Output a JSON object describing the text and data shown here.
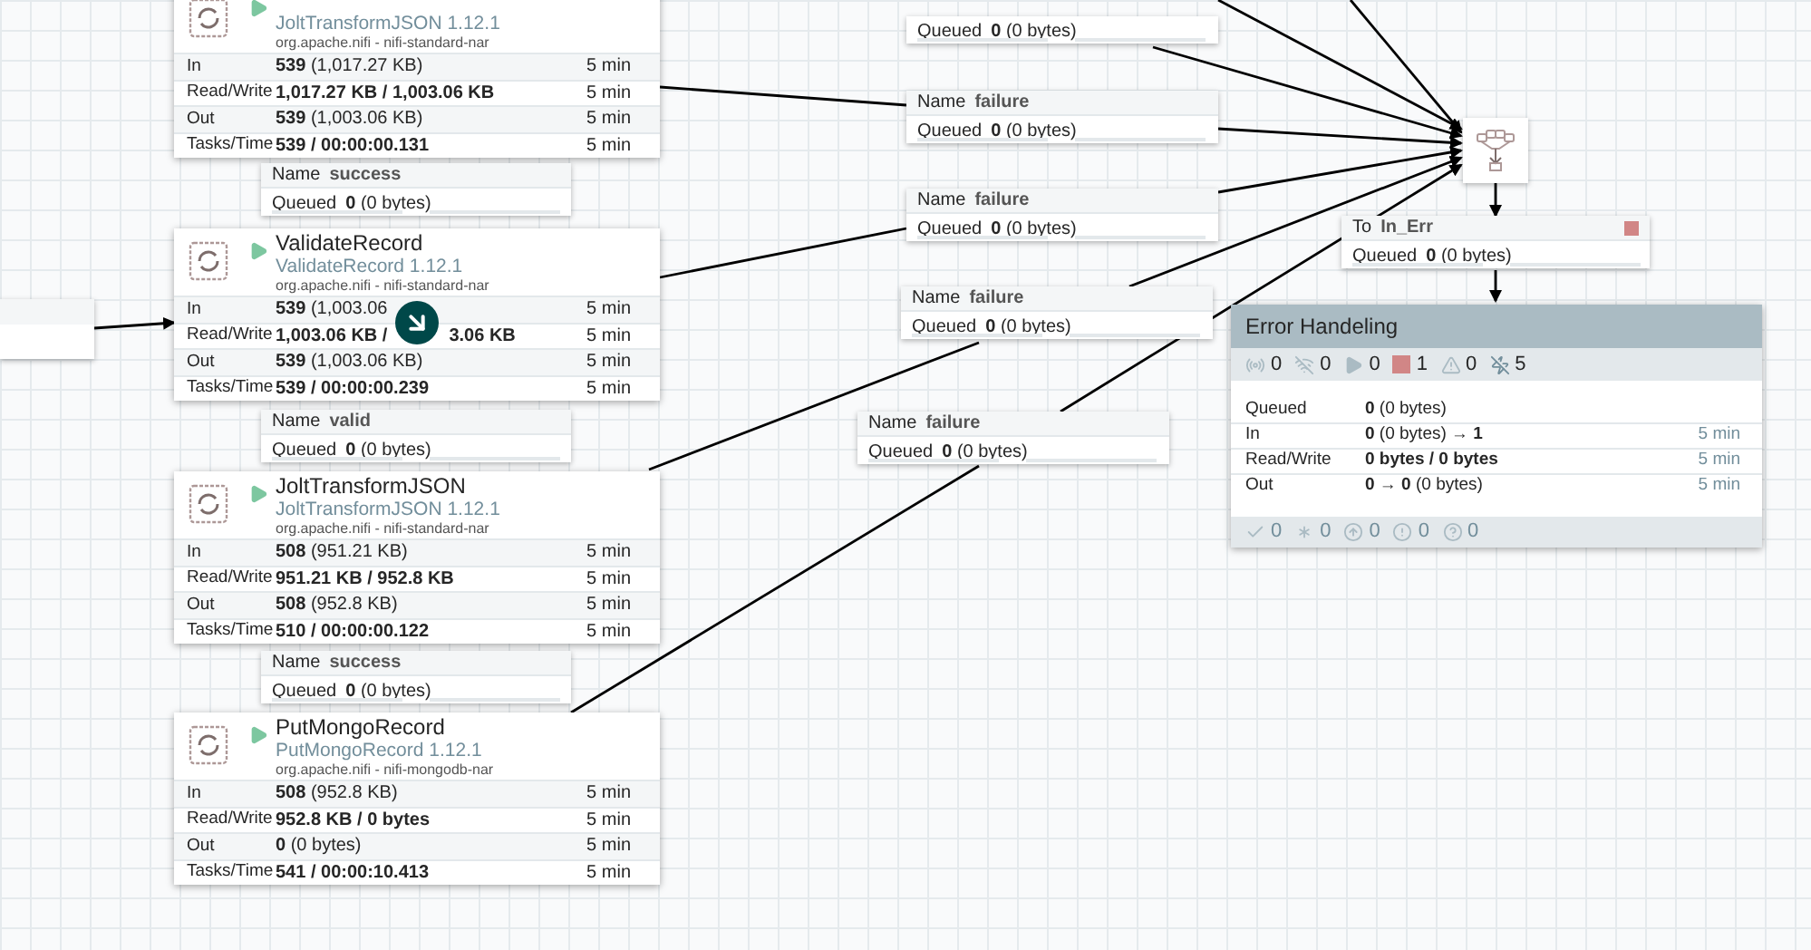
{
  "processors": [
    {
      "subtitle": "JoltTransformJSON 1.12.1",
      "bundle": "org.apache.nifi - nifi-standard-nar",
      "running": true,
      "rows": [
        {
          "label": "In",
          "value": "539",
          "detail": "(1,017.27 KB)",
          "time": "5 min"
        },
        {
          "label": "Read/Write",
          "value": "1,017.27 KB / 1,003.06 KB",
          "time": "5 min"
        },
        {
          "label": "Out",
          "value": "539",
          "detail": "(1,003.06 KB)",
          "time": "5 min"
        },
        {
          "label": "Tasks/Time",
          "value": "539 / 00:00:00.131",
          "time": "5 min"
        }
      ],
      "connection": {
        "name_label": "Name",
        "name": "success",
        "queued_label": "Queued",
        "count": "0",
        "size": "(0 bytes)"
      }
    },
    {
      "name": "ValidateRecord",
      "subtitle": "ValidateRecord 1.12.1",
      "bundle": "org.apache.nifi - nifi-standard-nar",
      "running": true,
      "rows": [
        {
          "label": "In",
          "value": "539",
          "detail": "(1,003.06",
          "time": "5 min"
        },
        {
          "label": "Read/Write",
          "value": "1,003.06 KB /",
          "after": "3.06 KB",
          "time": "5 min"
        },
        {
          "label": "Out",
          "value": "539",
          "detail": "(1,003.06 KB)",
          "time": "5 min"
        },
        {
          "label": "Tasks/Time",
          "value": "539 / 00:00:00.239",
          "time": "5 min"
        }
      ],
      "connection": {
        "name_label": "Name",
        "name": "valid",
        "queued_label": "Queued",
        "count": "0",
        "size": "(0 bytes)"
      }
    },
    {
      "name": "JoltTransformJSON",
      "subtitle": "JoltTransformJSON 1.12.1",
      "bundle": "org.apache.nifi - nifi-standard-nar",
      "running": true,
      "rows": [
        {
          "label": "In",
          "value": "508",
          "detail": "(951.21 KB)",
          "time": "5 min"
        },
        {
          "label": "Read/Write",
          "value": "951.21 KB / 952.8 KB",
          "time": "5 min"
        },
        {
          "label": "Out",
          "value": "508",
          "detail": "(952.8 KB)",
          "time": "5 min"
        },
        {
          "label": "Tasks/Time",
          "value": "510 / 00:00:00.122",
          "time": "5 min"
        }
      ],
      "connection": {
        "name_label": "Name",
        "name": "success",
        "queued_label": "Queued",
        "count": "0",
        "size": "(0 bytes)"
      }
    },
    {
      "name": "PutMongoRecord",
      "subtitle": "PutMongoRecord 1.12.1",
      "bundle": "org.apache.nifi - nifi-mongodb-nar",
      "running": true,
      "rows": [
        {
          "label": "In",
          "value": "508",
          "detail": "(952.8 KB)",
          "time": "5 min"
        },
        {
          "label": "Read/Write",
          "value": "952.8 KB / 0 bytes",
          "time": "5 min"
        },
        {
          "label": "Out",
          "value": "0",
          "detail": "(0 bytes)",
          "time": "5 min"
        },
        {
          "label": "Tasks/Time",
          "value": "541 / 00:00:10.413",
          "time": "5 min"
        }
      ]
    }
  ],
  "failure_connections": [
    {
      "queued_label": "Queued",
      "count": "0",
      "size": "(0 bytes)"
    },
    {
      "name_label": "Name",
      "name": "failure",
      "queued_label": "Queued",
      "count": "0",
      "size": "(0 bytes)"
    },
    {
      "name_label": "Name",
      "name": "failure",
      "queued_label": "Queued",
      "count": "0",
      "size": "(0 bytes)"
    },
    {
      "name_label": "Name",
      "name": "failure",
      "queued_label": "Queued",
      "count": "0",
      "size": "(0 bytes)"
    },
    {
      "name_label": "Name",
      "name": "failure",
      "queued_label": "Queued",
      "count": "0",
      "size": "(0 bytes)"
    }
  ],
  "output_connection": {
    "name_label": "To",
    "name": "In_Err",
    "queued_label": "Queued",
    "count": "0",
    "size": "(0 bytes)",
    "destination_stopped": true
  },
  "process_group": {
    "title": "Error Handeling",
    "status": [
      {
        "kind": "transmitting",
        "count": "0"
      },
      {
        "kind": "not_transmitting",
        "count": "0"
      },
      {
        "kind": "running",
        "count": "0"
      },
      {
        "kind": "stopped",
        "count": "1"
      },
      {
        "kind": "invalid",
        "count": "0"
      },
      {
        "kind": "disabled",
        "count": "5"
      }
    ],
    "rows": [
      {
        "label": "Queued",
        "value": "0",
        "detail": "(0 bytes)"
      },
      {
        "label": "In",
        "value": "0",
        "detail": "(0 bytes)",
        "after": "→ 1",
        "time": "5 min"
      },
      {
        "label": "Read/Write",
        "value": "0 bytes / 0 bytes",
        "time": "5 min"
      },
      {
        "label": "Out",
        "value": "0 → 0",
        "detail": "(0 bytes)",
        "time": "5 min"
      }
    ],
    "versions": [
      {
        "kind": "up_to_date",
        "count": "0"
      },
      {
        "kind": "locally_modified",
        "count": "0"
      },
      {
        "kind": "stale",
        "count": "0"
      },
      {
        "kind": "sync_failure",
        "count": "0"
      },
      {
        "kind": "unknown",
        "count": "0"
      }
    ]
  }
}
